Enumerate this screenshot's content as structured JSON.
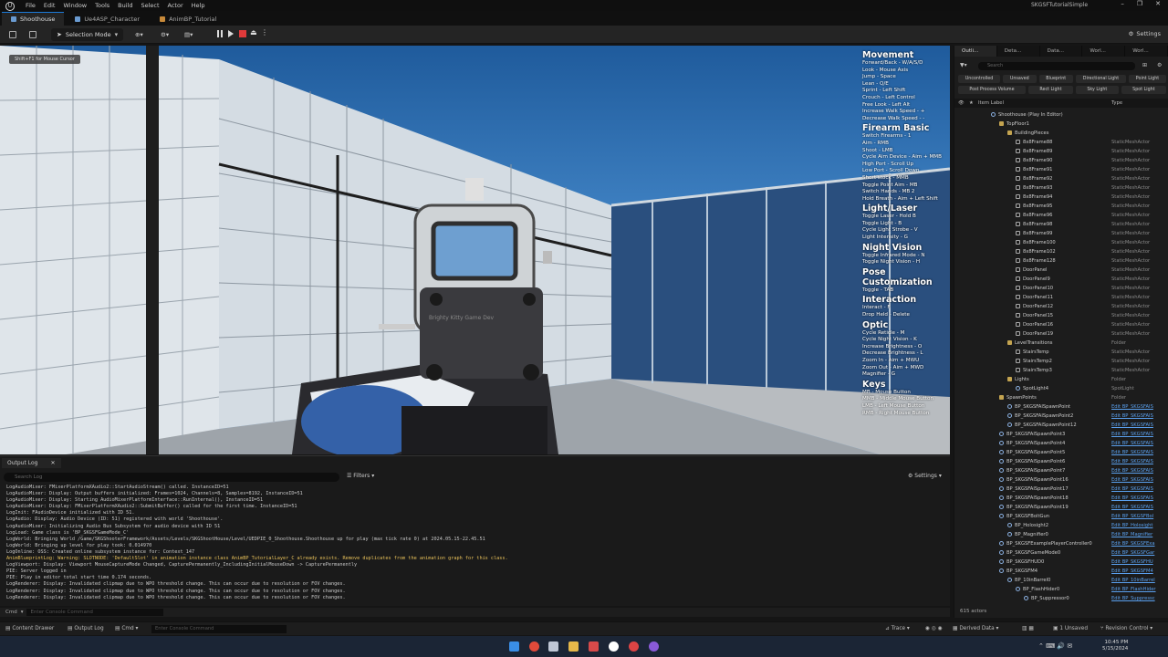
{
  "window": {
    "logo": "U",
    "project": "SKGSFTutorialSimple",
    "menu": [
      "File",
      "Edit",
      "Window",
      "Tools",
      "Build",
      "Select",
      "Actor",
      "Help"
    ],
    "tabs": [
      "Shoothouse",
      "Ue4ASP_Character",
      "AnimBP_Tutorial"
    ],
    "controls": [
      "–",
      "❐",
      "✕"
    ]
  },
  "toolbar": {
    "selection_mode": "Selection Mode",
    "settings": "Settings"
  },
  "viewport": {
    "hint": "Shift+F1 for Mouse Cursor",
    "sight_text": "Brighty Kitty Game Dev"
  },
  "controls_overlay": [
    {
      "title": "Movement",
      "lines": [
        "Forward/Back - W/A/S/D",
        "Look - Mouse Axis",
        "Jump - Space",
        "Lean - Q/E",
        "Sprint - Left Shift",
        "Crouch - Left Control",
        "Free Look - Left Alt",
        "Increase Walk Speed - +",
        "Decrease Walk Speed - -"
      ]
    },
    {
      "title": "Firearm Basic",
      "lines": [
        "Switch Firearms - 1",
        "Aim - RMB",
        "Shoot - LMB",
        "Cycle Aim Device - Aim + MMB",
        "High Port - Scroll Up",
        "Low Port - Scroll Down",
        "Short stock - MMB",
        "Toggle Point Aim - MB",
        "Switch Hands - MB 2",
        "Hold Breath - Aim + Left Shift"
      ]
    },
    {
      "title": "Light/Laser",
      "lines": [
        "Toggle Laser - Hold B",
        "Toggle Light - B",
        "Cycle Light Strobe - V",
        "Light Intensity - G"
      ]
    },
    {
      "title": "Night Vision",
      "lines": [
        "Toggle Infrared Mode - N",
        "Toggle Night Vision - H"
      ]
    },
    {
      "title": "Pose Customization",
      "lines": [
        "Toggle - TAB"
      ]
    },
    {
      "title": "Interaction",
      "lines": [
        "Interact - F",
        "Drop Held - Delete"
      ]
    },
    {
      "title": "Optic",
      "lines": [
        "Cycle Reticle - M",
        "Cycle Night Vision - K",
        "Increase Brightness - O",
        "Decrease Brightness - L",
        "Zoom In - Aim + MWU",
        "Zoom Out - Aim + MWD",
        "Magnifier - G"
      ]
    },
    {
      "title": "Keys",
      "lines": [
        "MB - Mouse Button",
        "MMB - Middle Mouse Button",
        "LMB - Left Mouse Button",
        "RMB - Right Mouse Button"
      ]
    }
  ],
  "output_log": {
    "tab_label": "Output Log",
    "close": "✕",
    "search_placeholder": "Search Log",
    "filters": "Filters",
    "settings": "Settings",
    "lines": [
      {
        "t": "LogAudioMixer: FMixerPlatformXAudio2::StartAudioStream() called. InstanceID=51",
        "w": false
      },
      {
        "t": "LogAudioMixer: Display: Output buffers initialized: Frames=1024, Channels=8, Samples=8192, InstanceID=51",
        "w": false
      },
      {
        "t": "LogAudioMixer: Display: Starting AudioMixerPlatformInterface::RunInternal(), InstanceID=51",
        "w": false
      },
      {
        "t": "LogAudioMixer: Display: FMixerPlatformXAudio2::SubmitBuffer() called for the first time. InstanceID=51",
        "w": false
      },
      {
        "t": "LogInit: FAudioDevice initialized with ID 51.",
        "w": false
      },
      {
        "t": "LogAudio: Display: Audio Device (ID: 51) registered with world 'Shoothouse'.",
        "w": false
      },
      {
        "t": "LogAudioMixer: Initializing Audio Bus Subsystem for audio device with ID 51",
        "w": false
      },
      {
        "t": "LogLoad: Game class is 'BP_SKGSFGameMode_C'",
        "w": false
      },
      {
        "t": "LogWorld: Bringing World /Game/SKGShooterFramework/Assets/Levels/SKGShootHouse/Level/UEDPIE_0_Shoothouse.Shoothouse up for play (max tick rate 0) at 2024.05.15-22.45.51",
        "w": false
      },
      {
        "t": "LogWorld: Bringing up level for play took: 0.014970",
        "w": false
      },
      {
        "t": "LogOnline: OSS: Created online subsystem instance for: Context_147",
        "w": false
      },
      {
        "t": "AnimBlueprintLog: Warning: SLOTNODE: 'DefaultSlot' in animation instance class AnimBP_TutorialLayer_C already exists. Remove duplicates from the animation graph for this class.",
        "w": true
      },
      {
        "t": "LogViewport: Display: Viewport MouseCaptureMode Changed, CapturePermanently_IncludingInitialMouseDown -> CapturePermanently",
        "w": false
      },
      {
        "t": "PIE: Server logged in",
        "w": false
      },
      {
        "t": "PIE: Play in editor total start time 0.174 seconds.",
        "w": false
      },
      {
        "t": "LogRenderer: Display: Invalidated clipmap due to WPO threshold change. This can occur due to resolution or FOV changes.",
        "w": false
      },
      {
        "t": "LogRenderer: Display: Invalidated clipmap due to WPO threshold change. This can occur due to resolution or FOV changes.",
        "w": false
      },
      {
        "t": "LogRenderer: Display: Invalidated clipmap due to WPO threshold change. This can occur due to resolution or FOV changes.",
        "w": false
      }
    ],
    "cmd_label": "Cmd",
    "cmd_placeholder": "Enter Console Command"
  },
  "outliner": {
    "tabs": [
      "Outli...",
      "Deta...",
      "Data...",
      "Worl...",
      "Worl..."
    ],
    "search_placeholder": "Search",
    "filters": [
      "Uncontrolled",
      "Unsaved",
      "Blueprint",
      "Directional Light",
      "Point Light",
      "Post Process Volume",
      "Rect Light",
      "Sky Light",
      "Spot Light"
    ],
    "col_label": "Item Label",
    "col_type": "Type",
    "rows": [
      {
        "name": "Shoothouse (Play In Editor)",
        "type": "",
        "indent": 0,
        "icon": "actor",
        "link": false
      },
      {
        "name": "TopFloor1",
        "type": "",
        "indent": 1,
        "icon": "folder",
        "link": false
      },
      {
        "name": "BuildingPieces",
        "type": "",
        "indent": 2,
        "icon": "folder",
        "link": false
      },
      {
        "name": "8x8Frame88",
        "type": "StaticMeshActor",
        "indent": 3,
        "icon": "mesh",
        "link": false
      },
      {
        "name": "8x8Frame89",
        "type": "StaticMeshActor",
        "indent": 3,
        "icon": "mesh",
        "link": false
      },
      {
        "name": "8x8Frame90",
        "type": "StaticMeshActor",
        "indent": 3,
        "icon": "mesh",
        "link": false
      },
      {
        "name": "8x8Frame91",
        "type": "StaticMeshActor",
        "indent": 3,
        "icon": "mesh",
        "link": false
      },
      {
        "name": "8x8Frame92",
        "type": "StaticMeshActor",
        "indent": 3,
        "icon": "mesh",
        "link": false
      },
      {
        "name": "8x8Frame93",
        "type": "StaticMeshActor",
        "indent": 3,
        "icon": "mesh",
        "link": false
      },
      {
        "name": "8x8Frame94",
        "type": "StaticMeshActor",
        "indent": 3,
        "icon": "mesh",
        "link": false
      },
      {
        "name": "8x8Frame95",
        "type": "StaticMeshActor",
        "indent": 3,
        "icon": "mesh",
        "link": false
      },
      {
        "name": "8x8Frame96",
        "type": "StaticMeshActor",
        "indent": 3,
        "icon": "mesh",
        "link": false
      },
      {
        "name": "8x8Frame98",
        "type": "StaticMeshActor",
        "indent": 3,
        "icon": "mesh",
        "link": false
      },
      {
        "name": "8x8Frame99",
        "type": "StaticMeshActor",
        "indent": 3,
        "icon": "mesh",
        "link": false
      },
      {
        "name": "8x8Frame100",
        "type": "StaticMeshActor",
        "indent": 3,
        "icon": "mesh",
        "link": false
      },
      {
        "name": "8x8Frame102",
        "type": "StaticMeshActor",
        "indent": 3,
        "icon": "mesh",
        "link": false
      },
      {
        "name": "8x8Frame128",
        "type": "StaticMeshActor",
        "indent": 3,
        "icon": "mesh",
        "link": false
      },
      {
        "name": "DoorPanel",
        "type": "StaticMeshActor",
        "indent": 3,
        "icon": "mesh",
        "link": false
      },
      {
        "name": "DoorPanel9",
        "type": "StaticMeshActor",
        "indent": 3,
        "icon": "mesh",
        "link": false
      },
      {
        "name": "DoorPanel10",
        "type": "StaticMeshActor",
        "indent": 3,
        "icon": "mesh",
        "link": false
      },
      {
        "name": "DoorPanel11",
        "type": "StaticMeshActor",
        "indent": 3,
        "icon": "mesh",
        "link": false
      },
      {
        "name": "DoorPanel12",
        "type": "StaticMeshActor",
        "indent": 3,
        "icon": "mesh",
        "link": false
      },
      {
        "name": "DoorPanel15",
        "type": "StaticMeshActor",
        "indent": 3,
        "icon": "mesh",
        "link": false
      },
      {
        "name": "DoorPanel16",
        "type": "StaticMeshActor",
        "indent": 3,
        "icon": "mesh",
        "link": false
      },
      {
        "name": "DoorPanel19",
        "type": "StaticMeshActor",
        "indent": 3,
        "icon": "mesh",
        "link": false
      },
      {
        "name": "LevelTransitions",
        "type": "Folder",
        "indent": 2,
        "icon": "folder",
        "link": false
      },
      {
        "name": "StairsTemp",
        "type": "StaticMeshActor",
        "indent": 3,
        "icon": "mesh",
        "link": false
      },
      {
        "name": "StairsTemp2",
        "type": "StaticMeshActor",
        "indent": 3,
        "icon": "mesh",
        "link": false
      },
      {
        "name": "StairsTemp3",
        "type": "StaticMeshActor",
        "indent": 3,
        "icon": "mesh",
        "link": false
      },
      {
        "name": "Lights",
        "type": "Folder",
        "indent": 2,
        "icon": "folder",
        "link": false
      },
      {
        "name": "SpotLight4",
        "type": "SpotLight",
        "indent": 3,
        "icon": "actor",
        "link": false
      },
      {
        "name": "SpawnPoints",
        "type": "Folder",
        "indent": 1,
        "icon": "folder",
        "link": false
      },
      {
        "name": "BP_SKGSFAISpawnPoint",
        "type": "Edit BP_SKGSFAIS",
        "indent": 2,
        "icon": "actor",
        "link": true
      },
      {
        "name": "BP_SKGSFAISpawnPoint2",
        "type": "Edit BP_SKGSFAIS",
        "indent": 2,
        "icon": "actor",
        "link": true
      },
      {
        "name": "BP_SKGSFAISpawnPoint12",
        "type": "Edit BP_SKGSFAIS",
        "indent": 2,
        "icon": "actor",
        "link": true
      },
      {
        "name": "BP_SKGSFAISpawnPoint3",
        "type": "Edit BP_SKGSFAIS",
        "indent": 1,
        "icon": "actor",
        "link": true
      },
      {
        "name": "BP_SKGSFAISpawnPoint4",
        "type": "Edit BP_SKGSFAIS",
        "indent": 1,
        "icon": "actor",
        "link": true
      },
      {
        "name": "BP_SKGSFAISpawnPoint5",
        "type": "Edit BP_SKGSFAIS",
        "indent": 1,
        "icon": "actor",
        "link": true
      },
      {
        "name": "BP_SKGSFAISpawnPoint6",
        "type": "Edit BP_SKGSFAIS",
        "indent": 1,
        "icon": "actor",
        "link": true
      },
      {
        "name": "BP_SKGSFAISpawnPoint7",
        "type": "Edit BP_SKGSFAIS",
        "indent": 1,
        "icon": "actor",
        "link": true
      },
      {
        "name": "BP_SKGSFAISpawnPoint16",
        "type": "Edit BP_SKGSFAIS",
        "indent": 1,
        "icon": "actor",
        "link": true
      },
      {
        "name": "BP_SKGSFAISpawnPoint17",
        "type": "Edit BP_SKGSFAIS",
        "indent": 1,
        "icon": "actor",
        "link": true
      },
      {
        "name": "BP_SKGSFAISpawnPoint18",
        "type": "Edit BP_SKGSFAIS",
        "indent": 1,
        "icon": "actor",
        "link": true
      },
      {
        "name": "BP_SKGSFAISpawnPoint19",
        "type": "Edit BP_SKGSFAIS",
        "indent": 1,
        "icon": "actor",
        "link": true
      },
      {
        "name": "BP_SKGSFBoltGun",
        "type": "Edit BP_SKGSFBol",
        "indent": 1,
        "icon": "actor",
        "link": true
      },
      {
        "name": "BP_Holosight2",
        "type": "Edit BP_Holosight",
        "indent": 2,
        "icon": "actor",
        "link": true
      },
      {
        "name": "BP_Magnifier0",
        "type": "Edit BP_Magnifier",
        "indent": 2,
        "icon": "actor",
        "link": true
      },
      {
        "name": "BP_SKGSFExamplePlayerController0",
        "type": "Edit BP_SKGSFExa",
        "indent": 1,
        "icon": "actor",
        "link": true
      },
      {
        "name": "BP_SKGSFGameMode0",
        "type": "Edit BP_SKGSFGar",
        "indent": 1,
        "icon": "actor",
        "link": true
      },
      {
        "name": "BP_SKGSFHUD0",
        "type": "Edit BP_SKGSFHU",
        "indent": 1,
        "icon": "actor",
        "link": true
      },
      {
        "name": "BP_SKGSFM4",
        "type": "Edit BP_SKGSFM4",
        "indent": 1,
        "icon": "actor",
        "link": true
      },
      {
        "name": "BP_10inBarrel0",
        "type": "Edit BP_10inBarrel",
        "indent": 2,
        "icon": "actor",
        "link": true
      },
      {
        "name": "BP_FlashHider0",
        "type": "Edit BP_FlashHider",
        "indent": 3,
        "icon": "actor",
        "link": true
      },
      {
        "name": "BP_Suppressor0",
        "type": "Edit BP_Suppressc",
        "indent": 4,
        "icon": "actor",
        "link": true
      }
    ],
    "actor_count": "615 actors"
  },
  "statusbar": {
    "content_drawer": "Content Drawer",
    "output_log": "Output Log",
    "cmd": "Cmd",
    "cmd_placeholder": "Enter Console Command",
    "trace": "Trace",
    "derived_data": "Derived Data",
    "unsaved": "1 Unsaved",
    "revision": "Revision Control"
  },
  "taskbar": {
    "time": "10:45 PM",
    "date": "5/15/2024"
  },
  "colors": {
    "accent": "#1d7ad8",
    "stop": "#e03a3a",
    "link": "#5aa0ee",
    "warning": "#e8c15a"
  }
}
